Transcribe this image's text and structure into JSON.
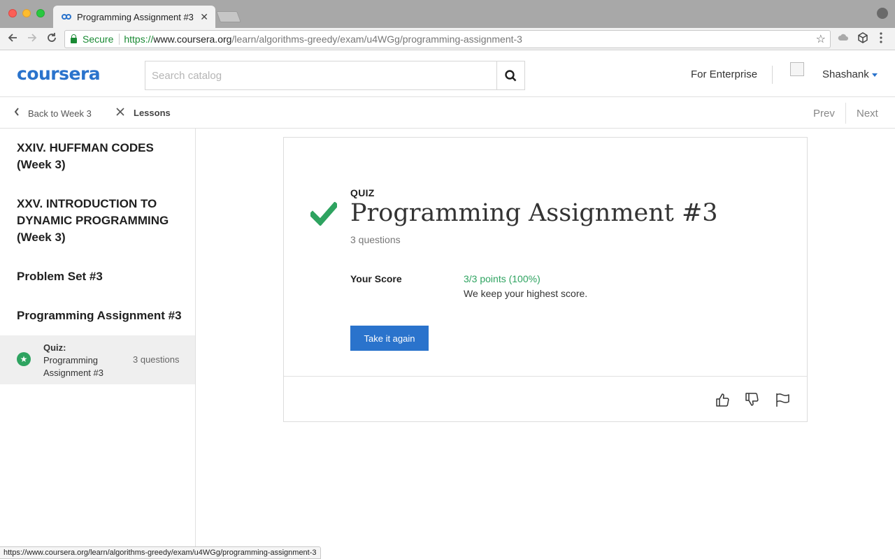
{
  "browser": {
    "tab_title": "Programming Assignment #3 |",
    "tab_close": "✕",
    "secure_label": "Secure",
    "url_scheme": "https://",
    "url_host": "www.coursera.org",
    "url_path": "/learn/algorithms-greedy/exam/u4WGg/programming-assignment-3",
    "status_url": "https://www.coursera.org/learn/algorithms-greedy/exam/u4WGg/programming-assignment-3"
  },
  "header": {
    "logo": "coursera",
    "search_placeholder": "Search catalog",
    "for_enterprise": "For Enterprise",
    "username": "Shashank"
  },
  "subnav": {
    "back_label": "Back to Week 3",
    "lessons_label": "Lessons",
    "prev": "Prev",
    "next": "Next"
  },
  "sidebar": {
    "lessons": [
      "XXIV. HUFFMAN CODES (Week 3)",
      "XXV. INTRODUCTION TO DYNAMIC PROGRAMMING (Week 3)",
      "Problem Set #3",
      "Programming Assignment #3"
    ],
    "active_item": {
      "type": "Quiz:",
      "title": "Programming Assignment #3",
      "count": "3 questions"
    }
  },
  "main": {
    "kind": "QUIZ",
    "title": "Programming Assignment #3",
    "question_count": "3 questions",
    "score_label": "Your Score",
    "score_value": "3/3 points (100%)",
    "score_note": "We keep your highest score.",
    "retake_button": "Take it again"
  },
  "colors": {
    "brand": "#2a73cc",
    "success": "#2ea360"
  },
  "icons": {
    "check": "check-icon",
    "thumbs_up": "thumbs-up-icon",
    "thumbs_down": "thumbs-down-icon",
    "flag": "flag-icon"
  }
}
